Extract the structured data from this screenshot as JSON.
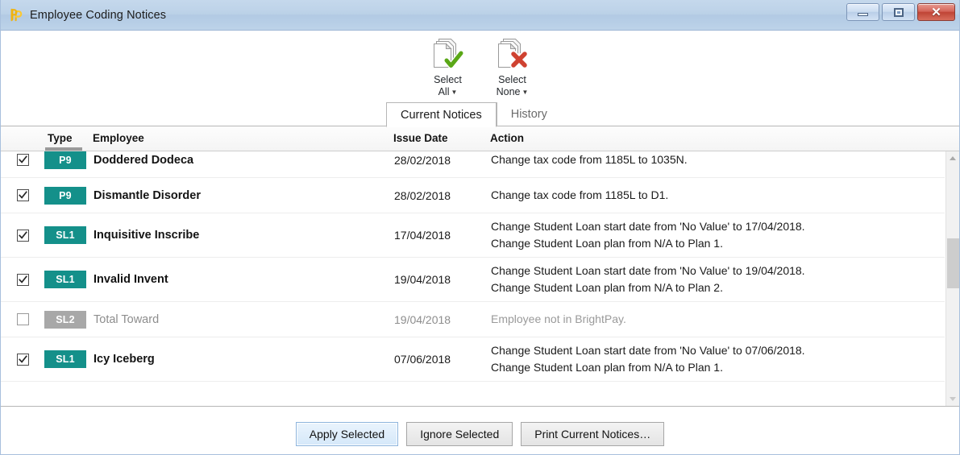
{
  "window": {
    "title": "Employee Coding Notices",
    "logo_icon": "brightpay-bp-logo",
    "controls": {
      "minimize": "minimize-icon",
      "maximize": "maximize-icon",
      "close": "close-icon"
    }
  },
  "toolbar": {
    "items": [
      {
        "line1": "Select",
        "line2": "All",
        "caret": "▼",
        "icon": "documents-check-icon"
      },
      {
        "line1": "Select",
        "line2": "None",
        "caret": "▼",
        "icon": "documents-x-icon"
      }
    ]
  },
  "tabs": [
    {
      "label": "Current Notices",
      "active": true
    },
    {
      "label": "History",
      "active": false
    }
  ],
  "table": {
    "columns": {
      "type": "Type",
      "employee": "Employee",
      "issue_date": "Issue Date",
      "action": "Action"
    },
    "sorted_column": "Type",
    "rows": [
      {
        "checked": true,
        "enabled": true,
        "type": "P9",
        "employee": "Doddered Dodeca",
        "issue_date": "28/02/2018",
        "action_lines": [
          "Change tax code from 1185L to 1035N."
        ]
      },
      {
        "checked": true,
        "enabled": true,
        "type": "P9",
        "employee": "Dismantle Disorder",
        "issue_date": "28/02/2018",
        "action_lines": [
          "Change tax code from 1185L to D1."
        ]
      },
      {
        "checked": true,
        "enabled": true,
        "type": "SL1",
        "employee": "Inquisitive Inscribe",
        "issue_date": "17/04/2018",
        "action_lines": [
          "Change Student Loan start date from 'No Value' to 17/04/2018.",
          "Change Student Loan plan from N/A to Plan 1."
        ]
      },
      {
        "checked": true,
        "enabled": true,
        "type": "SL1",
        "employee": "Invalid Invent",
        "issue_date": "19/04/2018",
        "action_lines": [
          "Change Student Loan start date from 'No Value' to 19/04/2018.",
          "Change Student Loan plan from N/A to Plan 2."
        ]
      },
      {
        "checked": false,
        "enabled": false,
        "type": "SL2",
        "employee": "Total Toward",
        "issue_date": "19/04/2018",
        "action_lines": [
          "Employee not in BrightPay."
        ]
      },
      {
        "checked": true,
        "enabled": true,
        "type": "SL1",
        "employee": "Icy Iceberg",
        "issue_date": "07/06/2018",
        "action_lines": [
          "Change Student Loan start date from 'No Value' to 07/06/2018.",
          "Change Student Loan plan from N/A to Plan 1."
        ]
      }
    ]
  },
  "footer": {
    "buttons": [
      {
        "label": "Apply Selected",
        "primary": true
      },
      {
        "label": "Ignore Selected",
        "primary": false
      },
      {
        "label": "Print Current Notices…",
        "primary": false
      }
    ]
  },
  "colors": {
    "badge_teal": "#14908a",
    "badge_gray": "#a8a8a8",
    "titlebar_blue": "#bcd2e8",
    "close_red": "#bf4436",
    "primary_button": "#d5e8f9"
  }
}
